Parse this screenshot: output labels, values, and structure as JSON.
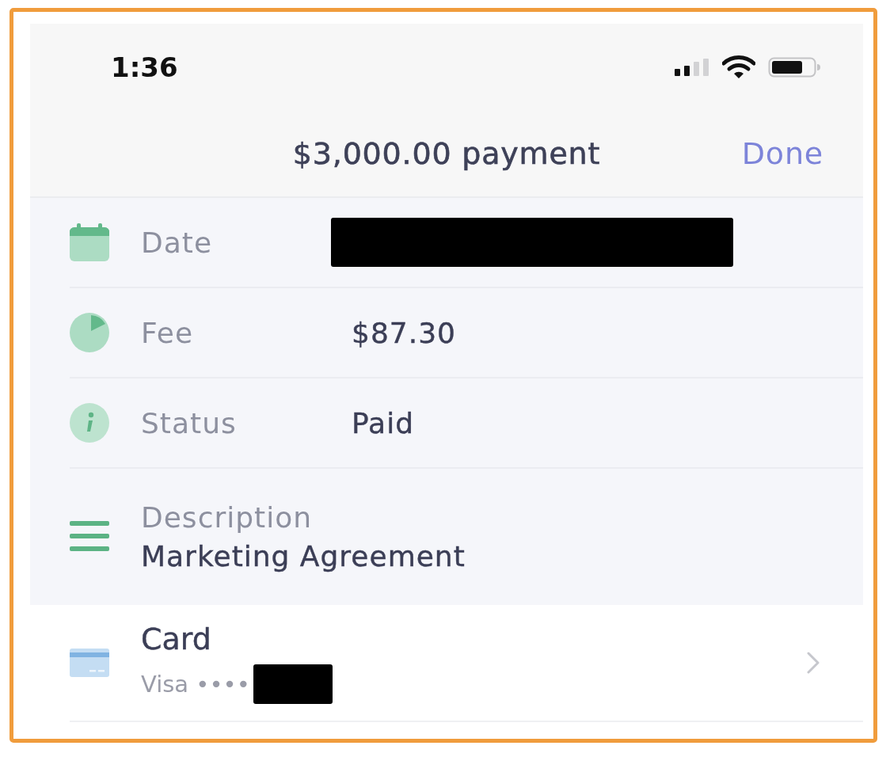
{
  "status_bar": {
    "time": "1:36"
  },
  "nav_bar": {
    "title": "$3,000.00 payment",
    "done_button": "Done"
  },
  "details": [
    {
      "kind": "inline",
      "label": "Date",
      "redacted": true
    },
    {
      "kind": "inline",
      "label": "Fee",
      "value": "$87.30"
    },
    {
      "kind": "inline",
      "label": "Status",
      "value": "Paid"
    },
    {
      "kind": "stacked",
      "label": "Description",
      "value": "Marketing Agreement"
    }
  ],
  "card_row": {
    "title": "Card",
    "subtitle": "Visa ••••",
    "redacted": true
  }
}
